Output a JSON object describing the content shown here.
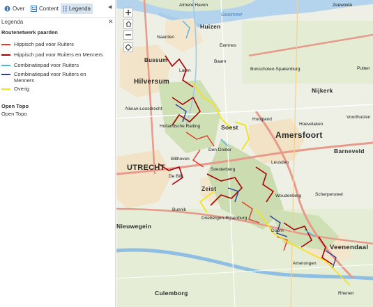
{
  "tabs": [
    {
      "label": "Over",
      "icon": "info-icon"
    },
    {
      "label": "Content",
      "icon": "content-icon"
    },
    {
      "label": "Legenda",
      "icon": "legend-icon",
      "active": true
    }
  ],
  "legend": {
    "title": "Legenda",
    "layer_name": "Routenetwerk paarden",
    "items": [
      {
        "label": "Hippisch pad voor Ruiters",
        "color": "#e8372c"
      },
      {
        "label": "Hippisch pad voor Ruiters en Menners",
        "color": "#a80000"
      },
      {
        "label": "Combinatiepad voor Ruiters",
        "color": "#49b6e6"
      },
      {
        "label": "Combinatiepad voor Ruiters en Menners",
        "color": "#2a3f9e"
      },
      {
        "label": "Overig",
        "color": "#f2e31c"
      }
    ],
    "basemap_title": "Open Topo",
    "basemap_sub": "Open Topo"
  },
  "map": {
    "labels": {
      "almere": "Almere Haven",
      "zeewolde": "Zeewolde",
      "gooimeer": "Gooimeer",
      "huizen": "Huizen",
      "naarden": "Naarden",
      "bussum": "Bussum",
      "eemnes": "Eemnes",
      "baarn": "Baarn",
      "bunschoten": "Bunschoten-Spakenburg",
      "hilversum": "Hilversum",
      "laren": "Laren",
      "putten": "Putten",
      "nijkerk": "Nijkerk",
      "loosdrecht": "Nieuw-Loosdrecht",
      "hollandsche": "Hollandsche Rading",
      "hoogland": "Hoogland",
      "hoevelaken": "Hoevelaken",
      "voorthuizen": "Voorthuizen",
      "soest": "Soest",
      "dendolder": "Den Dolder",
      "amersfoort": "Amersfoort",
      "bilthoven": "Bilthoven",
      "barneveld": "Barneveld",
      "utrecht": "UTRECHT",
      "debilt": "De Bilt",
      "leusden": "Leusden",
      "soesterberg": "Soesterberg",
      "zeist": "Zeist",
      "woudenberg": "Woudenberg",
      "scherpenzeel": "Scherpenzeel",
      "bunnik": "Bunnik",
      "driebergen": "Driebergen-Rijsenburg",
      "nieuwegein": "Nieuwegein",
      "doorn": "Doorn",
      "veenendaal": "Veenendaal",
      "amerongen": "Amerongen",
      "culemborg": "Culemborg",
      "rhenen": "Rhenen"
    }
  }
}
